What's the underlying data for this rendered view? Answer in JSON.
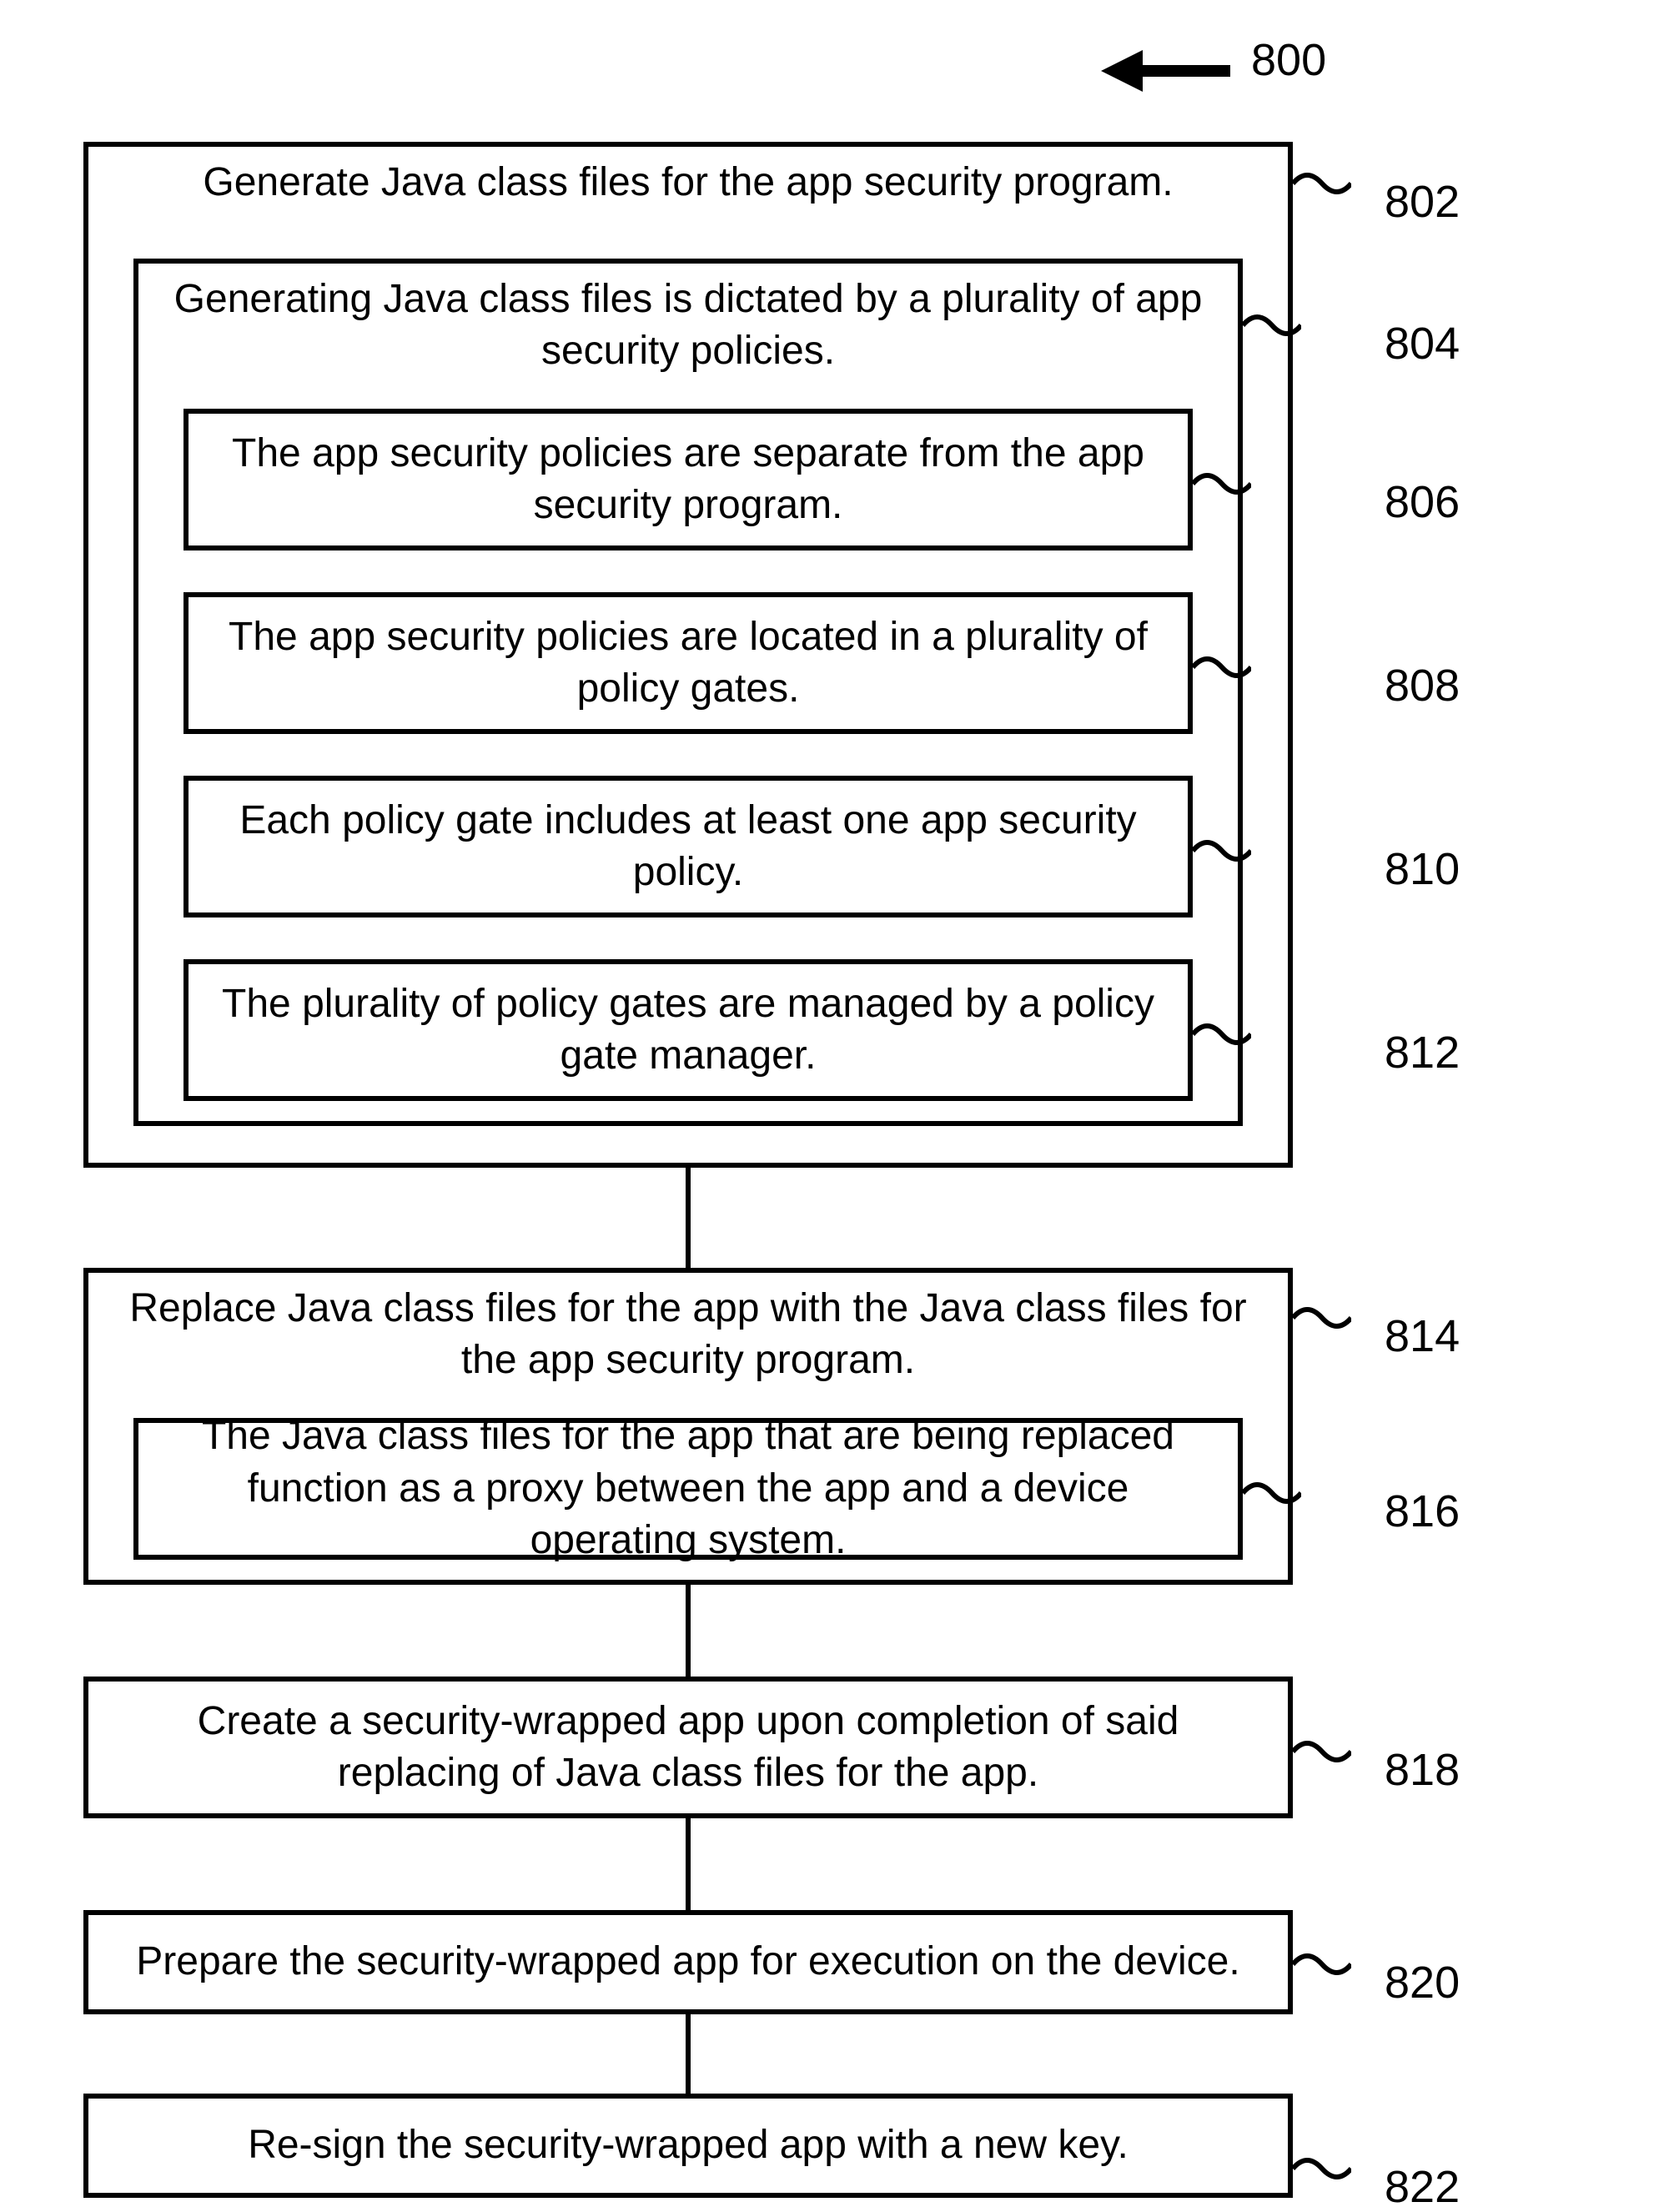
{
  "figure_ref": "800",
  "steps": {
    "s802": {
      "text": "Generate Java class files for the app security program.",
      "ref": "802"
    },
    "s804": {
      "text": "Generating Java class files is dictated by a plurality of app security policies.",
      "ref": "804"
    },
    "s806": {
      "text": "The app security policies are separate from the app security program.",
      "ref": "806"
    },
    "s808": {
      "text": "The app security policies are located in a plurality of policy gates.",
      "ref": "808"
    },
    "s810": {
      "text": "Each policy gate includes at least one app security policy.",
      "ref": "810"
    },
    "s812": {
      "text": "The plurality of policy gates are managed by a policy gate manager.",
      "ref": "812"
    },
    "s814": {
      "text": "Replace Java class files for the app with the Java class files for the app security program.",
      "ref": "814"
    },
    "s816": {
      "text": "The Java class files for the app that are being replaced function as a proxy between the app and a device operating system.",
      "ref": "816"
    },
    "s818": {
      "text": "Create a security-wrapped app upon completion of said replacing of Java class files for the app.",
      "ref": "818"
    },
    "s820": {
      "text": "Prepare the security-wrapped app for execution on the device.",
      "ref": "820"
    },
    "s822": {
      "text": "Re-sign the security-wrapped app with a new key.",
      "ref": "822"
    }
  }
}
